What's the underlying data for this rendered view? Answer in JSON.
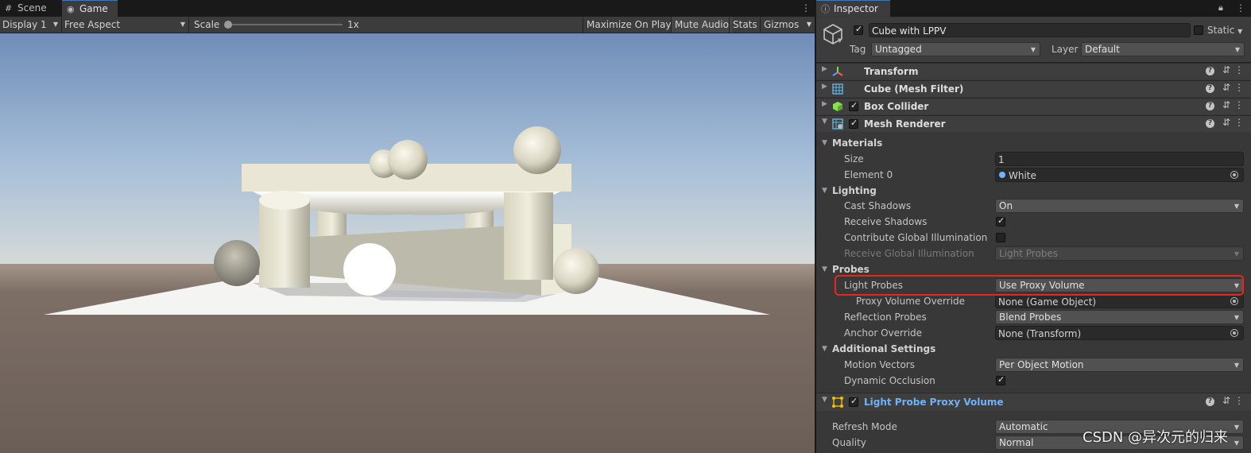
{
  "game_window": {
    "tabs": [
      {
        "label": "Scene",
        "icon": "grid-icon"
      },
      {
        "label": "Game",
        "icon": "gamepad-icon"
      }
    ],
    "toolbar": {
      "display": "Display 1",
      "aspect": "Free Aspect",
      "scale_label": "Scale",
      "scale_value": "1x",
      "scale_fraction": 0.0,
      "maximize_on_play": "Maximize On Play",
      "mute_audio": "Mute Audio",
      "stats": "Stats",
      "gizmos": "Gizmos"
    }
  },
  "inspector": {
    "tab_label": "Inspector",
    "object": {
      "name": "Cube with LPPV",
      "active": true,
      "static_label": "Static",
      "static": false,
      "tag_label": "Tag",
      "tag": "Untagged",
      "layer_label": "Layer",
      "layer": "Default"
    },
    "components": {
      "transform": "Transform",
      "mesh_filter": "Cube (Mesh Filter)",
      "box_collider": "Box Collider",
      "mesh_renderer": "Mesh Renderer",
      "lppv": "Light Probe Proxy Volume"
    },
    "mesh_renderer": {
      "materials_header": "Materials",
      "size_label": "Size",
      "size_value": "1",
      "element0_label": "Element 0",
      "element0_value": "White",
      "lighting_header": "Lighting",
      "cast_shadows_label": "Cast Shadows",
      "cast_shadows_value": "On",
      "receive_shadows_label": "Receive Shadows",
      "receive_shadows": true,
      "contribute_gi_label": "Contribute Global Illumination",
      "contribute_gi": false,
      "receive_gi_label": "Receive Global Illumination",
      "receive_gi_value": "Light Probes",
      "probes_header": "Probes",
      "light_probes_label": "Light Probes",
      "light_probes_value": "Use Proxy Volume",
      "proxy_override_label": "Proxy Volume Override",
      "proxy_override_value": "None (Game Object)",
      "reflection_probes_label": "Reflection Probes",
      "reflection_probes_value": "Blend Probes",
      "anchor_override_label": "Anchor Override",
      "anchor_override_value": "None (Transform)",
      "additional_header": "Additional Settings",
      "motion_vectors_label": "Motion Vectors",
      "motion_vectors_value": "Per Object Motion",
      "dynamic_occlusion_label": "Dynamic Occlusion",
      "dynamic_occlusion": true
    },
    "lppv": {
      "refresh_mode_label": "Refresh Mode",
      "refresh_mode_value": "Automatic",
      "quality_label": "Quality",
      "quality_value": "Normal"
    }
  },
  "watermark": "CSDN @异次元的归来",
  "colors": {
    "panel_bg": "#383838",
    "highlight": "#e8261e",
    "lppv_title": "#6cb3ff",
    "sky_top": "#6e8cb6",
    "ground": "#766960"
  }
}
